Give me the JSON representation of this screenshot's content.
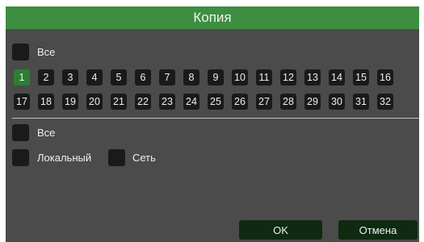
{
  "dialog": {
    "title": "Копия"
  },
  "channels": {
    "all_label": "Все",
    "selected": [
      1
    ],
    "row1": [
      "1",
      "2",
      "3",
      "4",
      "5",
      "6",
      "7",
      "8",
      "9",
      "10",
      "11",
      "12",
      "13",
      "14",
      "15",
      "16"
    ],
    "row2": [
      "17",
      "18",
      "19",
      "20",
      "21",
      "22",
      "23",
      "24",
      "25",
      "26",
      "27",
      "28",
      "29",
      "30",
      "31",
      "32"
    ]
  },
  "type": {
    "all_label": "Все",
    "local_label": "Локальный",
    "network_label": "Сеть"
  },
  "buttons": {
    "ok": "OK",
    "cancel": "Отмена"
  },
  "colors": {
    "title_bar": "#3e8e41",
    "panel": "#4b4b4b",
    "checkbox": "#1a1a1a",
    "selected": "#2b7f33",
    "button": "#0e2a11"
  }
}
